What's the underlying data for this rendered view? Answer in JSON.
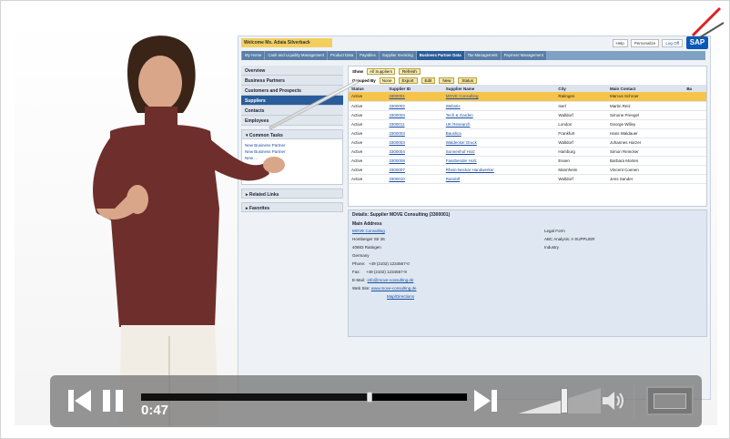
{
  "player": {
    "time_label": "0:47",
    "progress_fraction": 0.7,
    "volume_fraction": 0.55
  },
  "sap": {
    "welcome": "Welcome Ms. Adaia Silverback",
    "toplinks": [
      "Help",
      "Personalize",
      "Log Off"
    ],
    "logo": "SAP",
    "tabs": [
      "My Home",
      "Cash and Liquidity Management",
      "Product Data",
      "Payables",
      "Supplier Invoicing",
      "Business Partner Data",
      "Tax Management",
      "Payment Management"
    ],
    "active_tab": "Business Partner Data",
    "nav": [
      "Overview",
      "Business Partners",
      "Customers and Prospects",
      "Suppliers",
      "Contacts",
      "Employees"
    ],
    "selected_nav": "Suppliers",
    "common_tasks_title": "Common Tasks",
    "common_tasks": [
      "New Business Partner",
      "New Business Partner",
      "New ..."
    ],
    "related_links": "Related Links",
    "favorites": "Favorites",
    "toolbar": {
      "show_label": "Show",
      "show_value": "All Suppliers",
      "refresh": "Refresh",
      "grouped_by": "Grouped By",
      "grouped_value": "None",
      "export": "Export",
      "edit": "Edit",
      "new": "New",
      "status": "Status"
    },
    "columns": [
      "Status",
      "Supplier ID",
      "Supplier Name",
      "City",
      "Main Contact",
      "Ba"
    ],
    "rows": [
      [
        "Active",
        "3300001",
        "MOVE Consulting",
        "Ratingen",
        "Marcus Schroer",
        ""
      ],
      [
        "Active",
        "3300002",
        "Webstix",
        "Iserl",
        "Martin Reiz",
        ""
      ],
      [
        "Active",
        "3300003",
        "Tech & Garden",
        "Walldorf",
        "Simone Prengel",
        ""
      ],
      [
        "Active",
        "3300011",
        "UK Research",
        "London",
        "George Willey",
        ""
      ],
      [
        "Active",
        "3300003",
        "Bauslica",
        "Frankfurt",
        "Hans Waldauer",
        ""
      ],
      [
        "Active",
        "3300003",
        "Waldecker Druck",
        "Walldorf",
        "Johannes Harzer",
        ""
      ],
      [
        "Active",
        "3300004",
        "Sonnenhof Holz",
        "Hamburg",
        "Simon Reincker",
        ""
      ],
      [
        "Active",
        "3300008",
        "Fassbender Holz",
        "Essen",
        "Barbara Morten",
        ""
      ],
      [
        "Active",
        "3300007",
        "Rhein-Neckar Handwerker",
        "Mannheim",
        "Vincent Coenen",
        ""
      ],
      [
        "Active",
        "3300010",
        "Randolf",
        "Walldorf",
        "Jens Sander",
        ""
      ]
    ],
    "details": {
      "title": "Details: Supplier MOVE Consulting (3300001)",
      "heading": "Main Address",
      "left": [
        "MOVE Consulting",
        "Homberger Str 26",
        "40883 Ratingen",
        "Germany"
      ],
      "phone_label": "Phone:",
      "phone": "+49 (2102) 1234567-0",
      "fax_label": "Fax:",
      "fax": "+49 (2102) 1234567-9",
      "email_label": "E-Mail:",
      "email": "info@move-consulting.de",
      "web_label": "Web Site:",
      "web": "www.move-consulting.de",
      "map_link": "Map/Directions",
      "right": [
        "Legal Form",
        "ABC Analysis: A  SUPPLIER",
        "Industry"
      ]
    }
  },
  "colors": {
    "player_bg": "#787878",
    "sap_accent": "#2a5d9b",
    "highlight": "#f7c44b",
    "corner_red": "#e02020"
  }
}
